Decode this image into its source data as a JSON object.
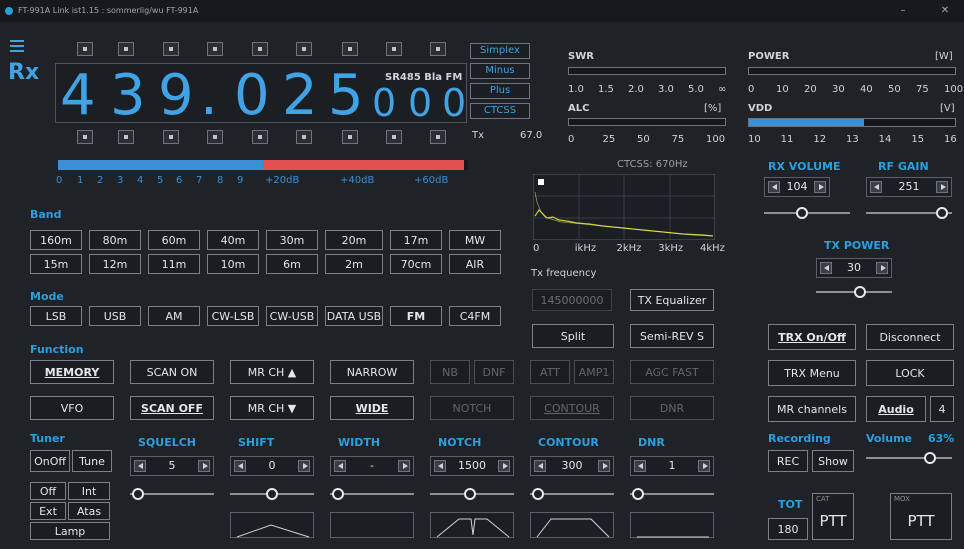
{
  "window": {
    "title": "FT-991A Link ist1.15 : sommerlig/wu FT-991A"
  },
  "vfo": {
    "mode_label": "Rx",
    "digits": [
      "4",
      "3",
      "9",
      ".",
      "0",
      "2",
      "5",
      "0",
      "0",
      "0"
    ],
    "tags": "SR485 Bla FM",
    "tx_label": "Tx",
    "tx_value": "67.0"
  },
  "shift_buttons": [
    "Simplex",
    "Minus",
    "Plus",
    "CTCSS"
  ],
  "smeter": {
    "scale": [
      "0",
      "1",
      "2",
      "3",
      "4",
      "5",
      "6",
      "7",
      "8",
      "9",
      "+20dB",
      "+40dB",
      "+60dB"
    ],
    "blue_fraction": 0.5,
    "red_fraction": 0.5
  },
  "swr": {
    "label": "SWR",
    "scale": [
      "1.0",
      "1.5",
      "2.0",
      "3.0",
      "5.0",
      "∞"
    ]
  },
  "alc": {
    "label": "ALC",
    "unit": "[%]",
    "scale": [
      "0",
      "25",
      "50",
      "75",
      "100"
    ]
  },
  "power": {
    "label": "POWER",
    "unit": "[W]",
    "scale": [
      "0",
      "10",
      "20",
      "30",
      "40",
      "50",
      "75",
      "100"
    ]
  },
  "vdd": {
    "label": "VDD",
    "unit": "[V]",
    "scale": [
      "10",
      "11",
      "12",
      "13",
      "14",
      "15",
      "16"
    ],
    "fill_fraction": 0.56
  },
  "rx_volume": {
    "label": "RX VOLUME",
    "value": "104"
  },
  "rf_gain": {
    "label": "RF GAIN",
    "value": "251"
  },
  "tx_power": {
    "label": "TX POWER",
    "value": "30"
  },
  "spectrum": {
    "ctcss": "CTCSS: 670Hz",
    "tick_labels": [
      "0",
      "ikHz",
      "2kHz",
      "3kHz",
      "4kHz"
    ],
    "tx_freq_label": "Tx frequency",
    "tx_freq_value": "145000000",
    "tx_eq": "TX Equalizer",
    "split": "Split",
    "semi": "Semi-REV S"
  },
  "band": {
    "label": "Band",
    "row1": [
      "160m",
      "80m",
      "60m",
      "40m",
      "30m",
      "20m",
      "17m",
      "MW"
    ],
    "row2": [
      "15m",
      "12m",
      "11m",
      "10m",
      "6m",
      "2m",
      "70cm",
      "AIR"
    ]
  },
  "mode": {
    "label": "Mode",
    "items": [
      "LSB",
      "USB",
      "AM",
      "CW-LSB",
      "CW-USB",
      "DATA USB",
      "FM",
      "C4FM"
    ]
  },
  "function": {
    "label": "Function",
    "row1": [
      "MEMORY",
      "SCAN ON",
      "MR CH ▲",
      "NARROW",
      "NB",
      "DNF",
      "ATT",
      "AMP1",
      "AGC FAST"
    ],
    "row2": [
      "VFO",
      "SCAN OFF",
      "MR CH ▼",
      "WIDE",
      "NOTCH",
      "CONTOUR",
      "DNR"
    ]
  },
  "right": {
    "trx_onoff": "TRX On/Off",
    "disconnect": "Disconnect",
    "trx_menu": "TRX Menu",
    "lock": "LOCK",
    "mr_channels": "MR channels",
    "audio": "Audio",
    "audio_num": "4",
    "recording": "Recording",
    "volume": "Volume",
    "volume_pct": "63%",
    "rec": "REC",
    "show": "Show",
    "tot": "TOT",
    "tot_value": "180",
    "cat": "CAT",
    "vox": "MOX",
    "ptt1": "PTT",
    "ptt2": "PTT"
  },
  "tuner": {
    "label": "Tuner",
    "onoff": "OnOff",
    "tune": "Tune",
    "off": "Off",
    "int": "Int",
    "ext": "Ext",
    "atas": "Atas",
    "lamp": "Lamp"
  },
  "knobs": {
    "squelch": {
      "label": "SQUELCH",
      "value": "5"
    },
    "shift": {
      "label": "SHIFT",
      "value": "0"
    },
    "width": {
      "label": "WIDTH",
      "value": "-"
    },
    "notch": {
      "label": "NOTCH",
      "value": "1500"
    },
    "contour": {
      "label": "CONTOUR",
      "value": "300"
    },
    "dnr": {
      "label": "DNR",
      "value": "1"
    }
  },
  "colors": {
    "accent": "#2b9fe0",
    "digits": "#3fa3e6",
    "smeter_blue": "#3a8fd8",
    "smeter_red": "#e05050",
    "background": "#1f2226"
  },
  "icons": [
    "menu-icon",
    "arrow-left-icon",
    "arrow-right-icon",
    "slider-thumb-icon"
  ]
}
